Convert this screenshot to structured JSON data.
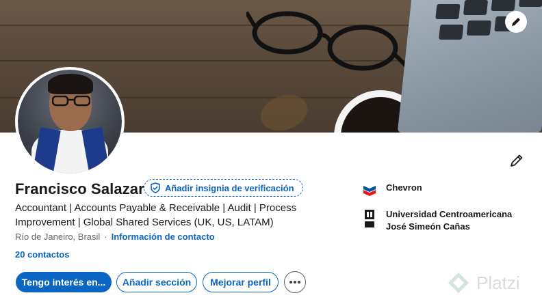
{
  "banner": {
    "edit_icon": "pencil-icon"
  },
  "profile": {
    "name": "Francisco Salazar",
    "verify_badge": "Añadir insignia de verificación",
    "headline": "Accountant | Accounts Payable & Receivable | Audit | Process Improvement | Global Shared Services (UK, US, LATAM)",
    "location": "Río de Janeiro, Brasil",
    "separator": "·",
    "contact_info": "Información de contacto",
    "connections": "20 contactos"
  },
  "actions": {
    "primary": "Tengo interés en...",
    "add_section": "Añadir sección",
    "improve_profile": "Mejorar perfil",
    "more": "more-icon"
  },
  "experience": {
    "company": "Chevron",
    "education_line1": "Universidad Centroamericana",
    "education_line2": "José Simeón Cañas"
  },
  "watermark": {
    "text": "Platzi"
  },
  "colors": {
    "accent": "#0a66c2",
    "text": "#191919",
    "muted": "#666666"
  }
}
